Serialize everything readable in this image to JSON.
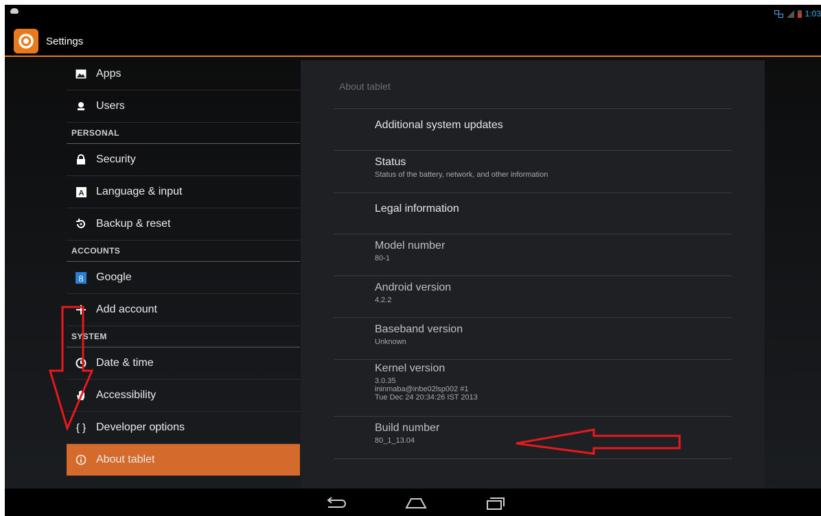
{
  "status_bar": {
    "clock": "1:03"
  },
  "action_bar": {
    "title": "Settings"
  },
  "sidebar": {
    "items": [
      {
        "type": "item",
        "label": "Apps",
        "icon": "apps-icon"
      },
      {
        "type": "item",
        "label": "Users",
        "icon": "users-icon"
      },
      {
        "type": "header",
        "label": "PERSONAL"
      },
      {
        "type": "item",
        "label": "Security",
        "icon": "lock-icon"
      },
      {
        "type": "item",
        "label": "Language & input",
        "icon": "keyboard-icon"
      },
      {
        "type": "item",
        "label": "Backup & reset",
        "icon": "backup-icon"
      },
      {
        "type": "header",
        "label": "ACCOUNTS"
      },
      {
        "type": "item",
        "label": "Google",
        "icon": "google-icon"
      },
      {
        "type": "item",
        "label": "Add account",
        "icon": "plus-icon"
      },
      {
        "type": "header",
        "label": "SYSTEM"
      },
      {
        "type": "item",
        "label": "Date & time",
        "icon": "clock-icon"
      },
      {
        "type": "item",
        "label": "Accessibility",
        "icon": "hand-icon"
      },
      {
        "type": "item",
        "label": "Developer options",
        "icon": "braces-icon"
      },
      {
        "type": "item",
        "label": "About tablet",
        "icon": "info-icon",
        "selected": true
      }
    ]
  },
  "detail": {
    "title": "About tablet",
    "rows": [
      {
        "title": "Additional system updates"
      },
      {
        "title": "Status",
        "sub": [
          "Status of the battery, network, and other information"
        ]
      },
      {
        "title": "Legal information"
      },
      {
        "title": "Model number",
        "sub": [
          "80-1"
        ]
      },
      {
        "title": "Android version",
        "sub": [
          "4.2.2"
        ]
      },
      {
        "title": "Baseband version",
        "sub": [
          "Unknown"
        ]
      },
      {
        "title": "Kernel version",
        "sub": [
          "3.0.35",
          "ininmaba@inbe02lsp002 #1",
          "Tue Dec 24 20:34:26 IST 2013"
        ]
      },
      {
        "title": "Build number",
        "sub": [
          "80_1_13.04"
        ]
      }
    ]
  },
  "nav_bar": {
    "buttons": [
      "back-icon",
      "home-icon",
      "recent-apps-icon"
    ]
  },
  "colors": {
    "accent": "#e47b22",
    "selected": "#d46b2c",
    "annotation": "#e8191c"
  }
}
